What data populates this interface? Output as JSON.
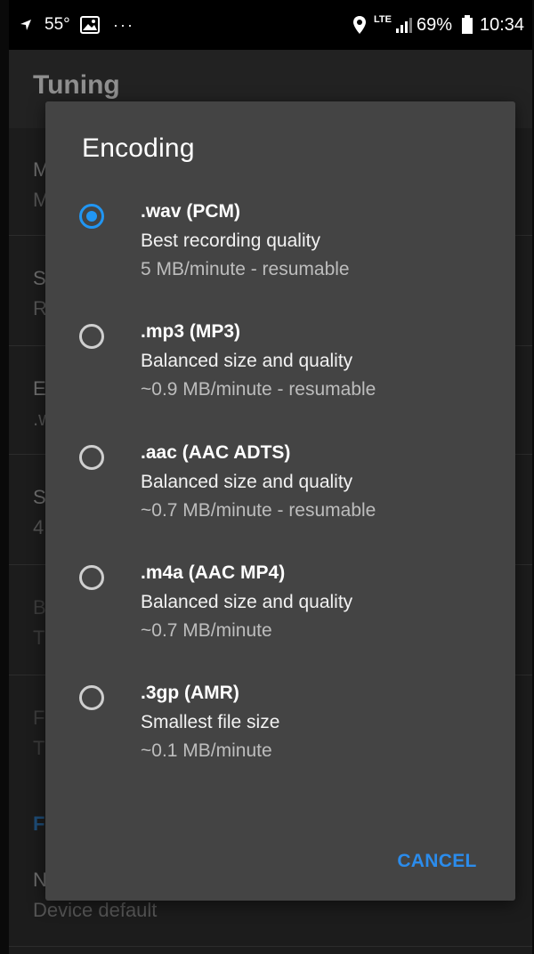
{
  "status_bar": {
    "temperature": "55°",
    "more": "···",
    "network": "LTE",
    "battery": "69%",
    "time": "10:34"
  },
  "background": {
    "title": "Tuning",
    "rows": [
      {
        "title": "M",
        "subtitle": "M"
      },
      {
        "title": "S",
        "subtitle": "R"
      },
      {
        "title": "E",
        "subtitle": ".w"
      },
      {
        "title": "S",
        "subtitle": "4"
      },
      {
        "title": "B",
        "subtitle": "T"
      },
      {
        "title": "F",
        "subtitle": "T"
      }
    ],
    "section_header": "F",
    "last_row": {
      "title": "N",
      "subtitle": "Device default"
    }
  },
  "dialog": {
    "title": "Encoding",
    "options": [
      {
        "title": ".wav (PCM)",
        "description": "Best recording quality",
        "meta": "5 MB/minute - resumable",
        "selected": true
      },
      {
        "title": ".mp3 (MP3)",
        "description": "Balanced size and quality",
        "meta": "~0.9 MB/minute - resumable",
        "selected": false
      },
      {
        "title": ".aac (AAC ADTS)",
        "description": "Balanced size and quality",
        "meta": "~0.7 MB/minute - resumable",
        "selected": false
      },
      {
        "title": ".m4a (AAC MP4)",
        "description": "Balanced size and quality",
        "meta": "~0.7 MB/minute",
        "selected": false
      },
      {
        "title": ".3gp (AMR)",
        "description": "Smallest file size",
        "meta": "~0.1 MB/minute",
        "selected": false
      }
    ],
    "cancel_label": "CANCEL"
  },
  "colors": {
    "accent": "#2196f3",
    "dialog_bg": "#444444",
    "cancel": "#2b8cec"
  }
}
